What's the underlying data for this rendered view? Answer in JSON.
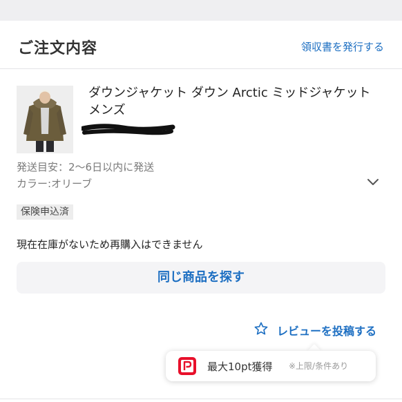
{
  "header": {
    "title": "ご注文内容",
    "receipt_link": "領収書を発行する"
  },
  "order_item": {
    "product_name": "ダウンジャケット ダウン Arctic ミッドジャケット メンズ",
    "shipping_estimate": "発送目安：2〜6日以内に発送",
    "color": "カラー:オリーブ",
    "insurance_badge": "保険申込済",
    "stock_message": "現在在庫がないため再購入はできません"
  },
  "actions": {
    "find_similar_label": "同じ商品を探す",
    "review_label": "レビューを投稿する"
  },
  "points_tooltip": {
    "text": "最大10pt獲得",
    "note": "※上限/条件あり"
  },
  "icons": {
    "review": "star-outline-icon",
    "expand": "chevron-down-icon",
    "points": "paypay-icon"
  },
  "colors": {
    "link_blue": "#1d6fc2",
    "paypay_red": "#e8102b"
  }
}
